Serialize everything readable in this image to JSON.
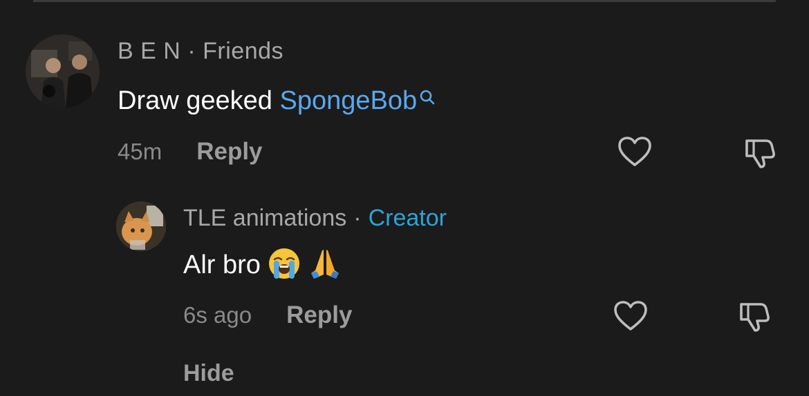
{
  "comment": {
    "username": "B E N",
    "separator": "·",
    "relation": "Friends",
    "text_prefix": "Draw geeked ",
    "text_link": "SpongeBob",
    "timestamp": "45m",
    "reply_label": "Reply"
  },
  "reply": {
    "username": "TLE animations",
    "separator": "·",
    "badge": "Creator",
    "text": "Alr bro",
    "emojis": [
      "loudly-crying-face",
      "folded-hands"
    ],
    "timestamp": "6s ago",
    "reply_label": "Reply"
  },
  "hide_label": "Hide",
  "colors": {
    "background": "#1b1b1b",
    "link": "#5aa8ef",
    "creator": "#2ea3d6",
    "muted": "#9c9c9c"
  },
  "icons": {
    "like": "heart-outline-icon",
    "dislike": "thumbs-down-outline-icon",
    "search": "search-icon"
  }
}
